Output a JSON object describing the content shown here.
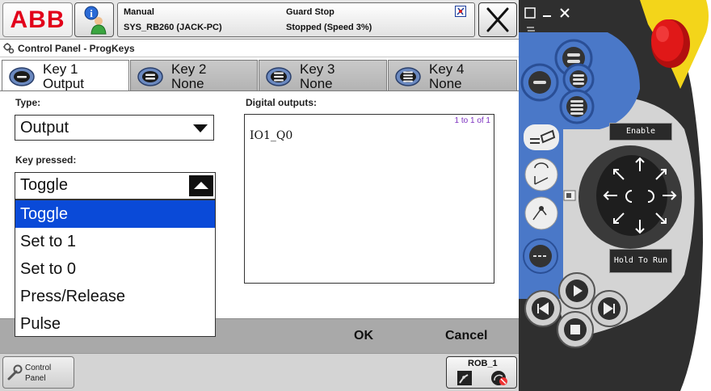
{
  "topbar": {
    "logo_text": "ABB",
    "mode": "Manual",
    "system": "SYS_RB260 (JACK-PC)",
    "guard_status": "Guard Stop",
    "run_status": "Stopped (Speed 3%)"
  },
  "window": {
    "title": "Control Panel - ProgKeys"
  },
  "tabs": [
    {
      "label": "Key 1",
      "value": "Output"
    },
    {
      "label": "Key 2",
      "value": "None"
    },
    {
      "label": "Key 3",
      "value": "None"
    },
    {
      "label": "Key 4",
      "value": "None"
    }
  ],
  "form": {
    "type_label": "Type:",
    "type_value": "Output",
    "key_pressed_label": "Key pressed:",
    "key_pressed_value": "Toggle",
    "dropdown_options": [
      "Toggle",
      "Set to 1",
      "Set to 0",
      "Press/Release",
      "Pulse"
    ],
    "selected_option_index": 0,
    "digital_outputs_label": "Digital outputs:",
    "digital_outputs_count": "1 to 1 of 1",
    "digital_outputs": [
      "IO1_Q0"
    ]
  },
  "commands": {
    "ok": "OK",
    "cancel": "Cancel"
  },
  "taskbar": {
    "control_panel_line1": "Control",
    "control_panel_line2": "Panel",
    "rob_label": "ROB_1"
  },
  "pendant": {
    "enable_label": "Enable",
    "hold_to_run_label": "Hold To Run"
  },
  "colors": {
    "selection": "#0a4ad8",
    "abb_red": "#e2001a",
    "pendant_blue": "#4a78c8",
    "pendant_dark": "#2f2f2f",
    "emergency_red": "#d21414",
    "pendant_yellow": "#f3d51a"
  }
}
